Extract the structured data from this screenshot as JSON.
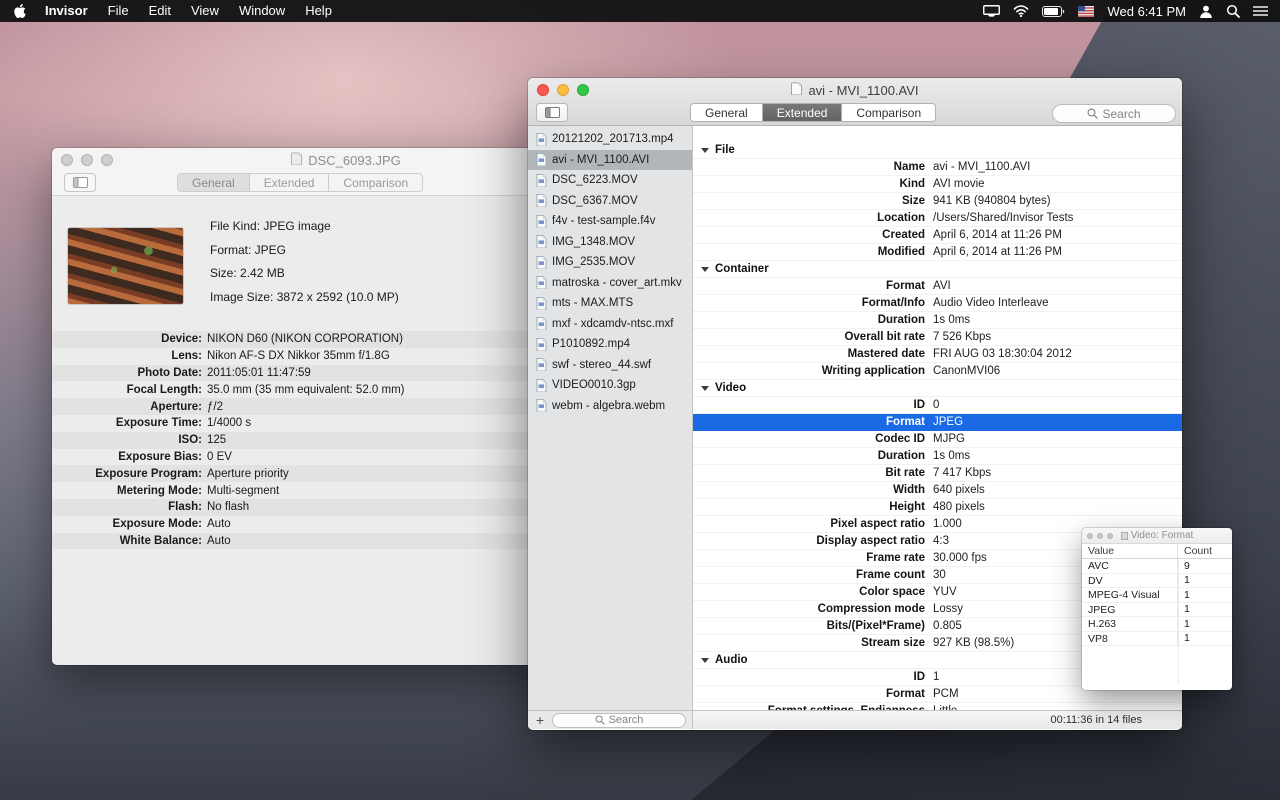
{
  "icons": {
    "apple": "apple-logo",
    "menubar_right": [
      "display-mirroring",
      "wifi",
      "battery-charging",
      "us-flag",
      "user",
      "spotlight-search",
      "notification-center"
    ],
    "sidebar_toggle": "sidebar-panel-toggle",
    "search": "magnifier",
    "disclosure": "triangle-down",
    "file": "document"
  },
  "menu_bar": {
    "app_name": "Invisor",
    "menus": [
      "File",
      "Edit",
      "View",
      "Window",
      "Help"
    ],
    "clock": "Wed 6:41 PM"
  },
  "back_window": {
    "title": "DSC_6093.JPG",
    "tabs": [
      "General",
      "Extended",
      "Comparison"
    ],
    "active_tab": "General",
    "summary": [
      {
        "label": "File Kind:",
        "value": "JPEG image"
      },
      {
        "label": "Format:",
        "value": "JPEG"
      },
      {
        "label": "Size:",
        "value": "2.42 MB"
      },
      {
        "label": "Image Size:",
        "value": "3872 x 2592 (10.0 MP)"
      }
    ],
    "details": [
      {
        "label": "Device:",
        "value": "NIKON D60 (NIKON CORPORATION)"
      },
      {
        "label": "Lens:",
        "value": "Nikon AF-S DX Nikkor 35mm f/1.8G"
      },
      {
        "label": "Photo Date:",
        "value": "2011:05:01 11:47:59"
      },
      {
        "label": "Focal Length:",
        "value": "35.0 mm (35 mm equivalent: 52.0 mm)"
      },
      {
        "label": "Aperture:",
        "value": "ƒ/2"
      },
      {
        "label": "Exposure Time:",
        "value": "1/4000 s"
      },
      {
        "label": "ISO:",
        "value": "125"
      },
      {
        "label": "Exposure Bias:",
        "value": "0 EV"
      },
      {
        "label": "Exposure Program:",
        "value": "Aperture priority"
      },
      {
        "label": "Metering Mode:",
        "value": "Multi-segment"
      },
      {
        "label": "Flash:",
        "value": "No flash"
      },
      {
        "label": "Exposure Mode:",
        "value": "Auto"
      },
      {
        "label": "White Balance:",
        "value": "Auto"
      }
    ]
  },
  "front_window": {
    "title": "avi - MVI_1100.AVI",
    "tabs": [
      "General",
      "Extended",
      "Comparison"
    ],
    "active_tab": "Extended",
    "toolbar_search_placeholder": "Search",
    "sidebar": {
      "files": [
        {
          "name": "20121202_201713.mp4"
        },
        {
          "name": "avi - MVI_1100.AVI",
          "selected": true
        },
        {
          "name": "DSC_6223.MOV"
        },
        {
          "name": "DSC_6367.MOV"
        },
        {
          "name": "f4v - test-sample.f4v"
        },
        {
          "name": "IMG_1348.MOV"
        },
        {
          "name": "IMG_2535.MOV"
        },
        {
          "name": "matroska - cover_art.mkv"
        },
        {
          "name": "mts - MAX.MTS"
        },
        {
          "name": "mxf - xdcamdv-ntsc.mxf"
        },
        {
          "name": "P1010892.mp4"
        },
        {
          "name": "swf - stereo_44.swf"
        },
        {
          "name": "VIDEO0010.3gp"
        },
        {
          "name": "webm - algebra.webm"
        }
      ],
      "add_button": "+",
      "search_placeholder": "Search"
    },
    "sections": [
      {
        "title": "File",
        "rows": [
          {
            "label": "Name",
            "value": "avi - MVI_1100.AVI"
          },
          {
            "label": "Kind",
            "value": "AVI movie"
          },
          {
            "label": "Size",
            "value": "941 KB (940804 bytes)"
          },
          {
            "label": "Location",
            "value": "/Users/Shared/Invisor Tests"
          },
          {
            "label": "Created",
            "value": "April 6, 2014 at 11:26 PM"
          },
          {
            "label": "Modified",
            "value": "April 6, 2014 at 11:26 PM"
          }
        ]
      },
      {
        "title": "Container",
        "rows": [
          {
            "label": "Format",
            "value": "AVI"
          },
          {
            "label": "Format/Info",
            "value": "Audio Video Interleave"
          },
          {
            "label": "Duration",
            "value": "1s 0ms"
          },
          {
            "label": "Overall bit rate",
            "value": "7 526 Kbps"
          },
          {
            "label": "Mastered date",
            "value": "FRI AUG 03 18:30:04 2012"
          },
          {
            "label": "Writing application",
            "value": "CanonMVI06"
          }
        ]
      },
      {
        "title": "Video",
        "rows": [
          {
            "label": "ID",
            "value": "0"
          },
          {
            "label": "Format",
            "value": "JPEG",
            "selected": true
          },
          {
            "label": "Codec ID",
            "value": "MJPG"
          },
          {
            "label": "Duration",
            "value": "1s 0ms"
          },
          {
            "label": "Bit rate",
            "value": "7 417 Kbps"
          },
          {
            "label": "Width",
            "value": "640 pixels"
          },
          {
            "label": "Height",
            "value": "480 pixels"
          },
          {
            "label": "Pixel aspect ratio",
            "value": "1.000"
          },
          {
            "label": "Display aspect ratio",
            "value": "4:3"
          },
          {
            "label": "Frame rate",
            "value": "30.000 fps"
          },
          {
            "label": "Frame count",
            "value": "30"
          },
          {
            "label": "Color space",
            "value": "YUV"
          },
          {
            "label": "Compression mode",
            "value": "Lossy"
          },
          {
            "label": "Bits/(Pixel*Frame)",
            "value": "0.805"
          },
          {
            "label": "Stream size",
            "value": "927 KB (98.5%)"
          }
        ]
      },
      {
        "title": "Audio",
        "rows": [
          {
            "label": "ID",
            "value": "1"
          },
          {
            "label": "Format",
            "value": "PCM"
          },
          {
            "label": "Format settings, Endianness",
            "value": "Little"
          }
        ]
      }
    ],
    "status_bar": "00:11:36 in 14 files"
  },
  "popup": {
    "title": "Video: Format",
    "columns": [
      "Value",
      "Count"
    ],
    "rows": [
      {
        "value": "AVC",
        "count": "9"
      },
      {
        "value": "DV",
        "count": "1"
      },
      {
        "value": "MPEG-4 Visual",
        "count": "1"
      },
      {
        "value": "JPEG",
        "count": "1"
      },
      {
        "value": "H.263",
        "count": "1"
      },
      {
        "value": "VP8",
        "count": "1"
      }
    ]
  }
}
